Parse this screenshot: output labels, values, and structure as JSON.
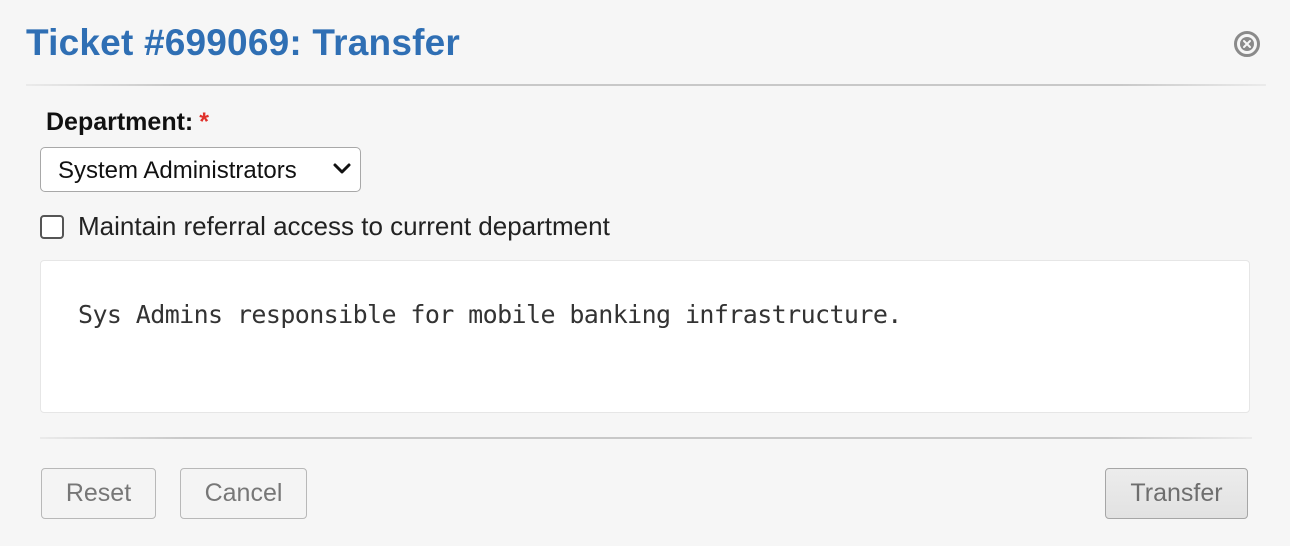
{
  "dialog": {
    "title": "Ticket #699069: Transfer",
    "close_icon": "close-circle-icon"
  },
  "form": {
    "department_label": "Department:",
    "required_marker": "*",
    "department_selected": "System Administrators",
    "select_icon": "chevron-down-icon",
    "referral_checkbox_checked": false,
    "referral_checkbox_label": "Maintain referral access to current department",
    "description": "Sys Admins responsible for mobile banking infrastructure."
  },
  "buttons": {
    "reset_label": "Reset",
    "cancel_label": "Cancel",
    "transfer_label": "Transfer"
  },
  "colors": {
    "title": "#2f6fb4",
    "required": "#e0312b",
    "background": "#f6f6f6"
  }
}
